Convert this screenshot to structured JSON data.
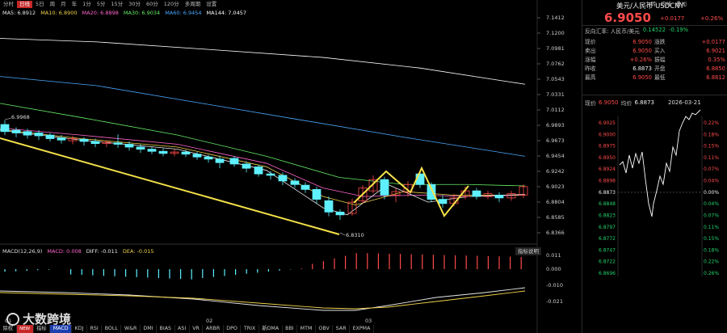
{
  "top_tabs": [
    "分时",
    "日线",
    "5日",
    "周",
    "月",
    "年",
    "1分",
    "5分",
    "15分",
    "30分",
    "60分",
    "120分",
    "多周期",
    "设置"
  ],
  "active_tab_index": 1,
  "top_right": [
    "九转",
    "均线",
    "叠加"
  ],
  "ma": {
    "ma5": "MA5: 6.8912",
    "ma10": "MA10: 6.8900",
    "ma20": "MA20: 6.8898",
    "ma30": "MA30: 6.9034",
    "ma60": "MA60: 6.9454",
    "ma144": "MA144: 7.0457"
  },
  "colors": {
    "up": "#ff4a4a",
    "down": "#5ef0ff",
    "ma5": "#e8e8e8",
    "ma10": "#f0d24a",
    "ma20": "#ff66cc",
    "ma30": "#66ee66",
    "ma60": "#4aa8ff",
    "ma144": "#ffffff",
    "trend": "#f5e14a"
  },
  "price_axis": [
    "7.1412",
    "7.1200",
    "7.0981",
    "7.0762",
    "7.0543",
    "7.0331",
    "7.0112",
    "6.9893",
    "6.9673",
    "6.9454",
    "6.9242",
    "6.9023",
    "6.8804",
    "6.8585",
    "6.8366"
  ],
  "annotations": {
    "high": "6.9968",
    "low": "6.8310"
  },
  "x_labels": [
    "01",
    "02",
    "03"
  ],
  "macd": {
    "label": "MACD(12,26,9)",
    "macd": "MACD: 0.008",
    "diff": "DIFF: -0.011",
    "dea": "DEA: -0.015",
    "explain": "指标说明",
    "axis": [
      "0.011",
      "0.000",
      "-0.010",
      "-0.021"
    ]
  },
  "bottom_tabs": [
    "除权",
    "NEW",
    "指标",
    "MACD",
    "KDJ",
    "RSI",
    "BOLL",
    "W&R",
    "DMI",
    "BIAS",
    "ASI",
    "VR",
    "ARBR",
    "DPO",
    "TRIX",
    "新DMA",
    "BBI",
    "MTM",
    "OBV",
    "SAR",
    "EXPMA"
  ],
  "active_bottom_index": 3,
  "watermark": "大数跨境",
  "panel": {
    "title": "美元/人民币 USDCNY",
    "price": "6.9050",
    "change": "+0.0177",
    "pct": "+0.26%",
    "reverse_label": "反向汇率: 人民币/美元",
    "reverse_value": "0.14522",
    "reverse_pct": "-0.19%",
    "rows": [
      [
        "现价",
        "6.9050",
        "涨跌",
        "+0.0177"
      ],
      [
        "卖出",
        "6.9050",
        "买入",
        "6.9021"
      ],
      [
        "涨幅",
        "+0.26%",
        "振幅",
        "0.35%"
      ],
      [
        "昨收",
        "6.8873",
        "开盘",
        "6.8850"
      ],
      [
        "最高",
        "6.9050",
        "最低",
        "6.8812"
      ]
    ],
    "intraday_label_price": "现价",
    "intraday_price": "6.9050",
    "intraday_label_avg": "均价",
    "intraday_avg": "6.8873",
    "date": "2026-03-21",
    "left_axis": [
      "6.9025",
      "6.9000",
      "6.8975",
      "6.8950",
      "6.8924",
      "6.8898",
      "6.8873",
      "6.8848",
      "6.8823",
      "6.8797",
      "6.8772",
      "6.8747",
      "6.8722",
      "6.8696"
    ],
    "right_axis": [
      "0.22%",
      "0.18%",
      "0.15%",
      "0.11%",
      "0.07%",
      "0.04%",
      "0.00%",
      "0.04%",
      "0.07%",
      "0.11%",
      "0.15%",
      "0.18%",
      "0.22%",
      "0.26%"
    ]
  }
}
